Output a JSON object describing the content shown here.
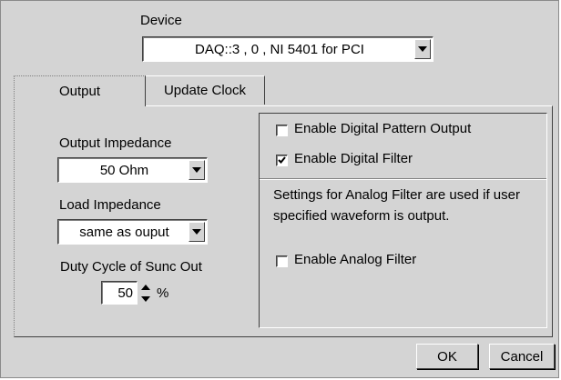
{
  "device": {
    "label": "Device",
    "value": "DAQ::3 , 0 , NI 5401 for PCI"
  },
  "tabs": [
    {
      "label": "Output",
      "selected": true
    },
    {
      "label": "Update Clock",
      "selected": false
    }
  ],
  "left": {
    "output_impedance_label": "Output Impedance",
    "output_impedance_value": "50 Ohm",
    "load_impedance_label": "Load Impedance",
    "load_impedance_value": "same as ouput",
    "duty_cycle_label": "Duty Cycle of Sunc Out",
    "duty_cycle_value": "50",
    "duty_cycle_unit": "%"
  },
  "right": {
    "enable_digital_pattern_label": "Enable Digital Pattern Output",
    "enable_digital_pattern_checked": false,
    "enable_digital_filter_label": "Enable Digital Filter",
    "enable_digital_filter_checked": true,
    "analog_note": "Settings for Analog Filter are used if user specified waveform is output.",
    "enable_analog_filter_label": "Enable Analog Filter",
    "enable_analog_filter_checked": false
  },
  "buttons": {
    "ok": "OK",
    "cancel": "Cancel"
  }
}
